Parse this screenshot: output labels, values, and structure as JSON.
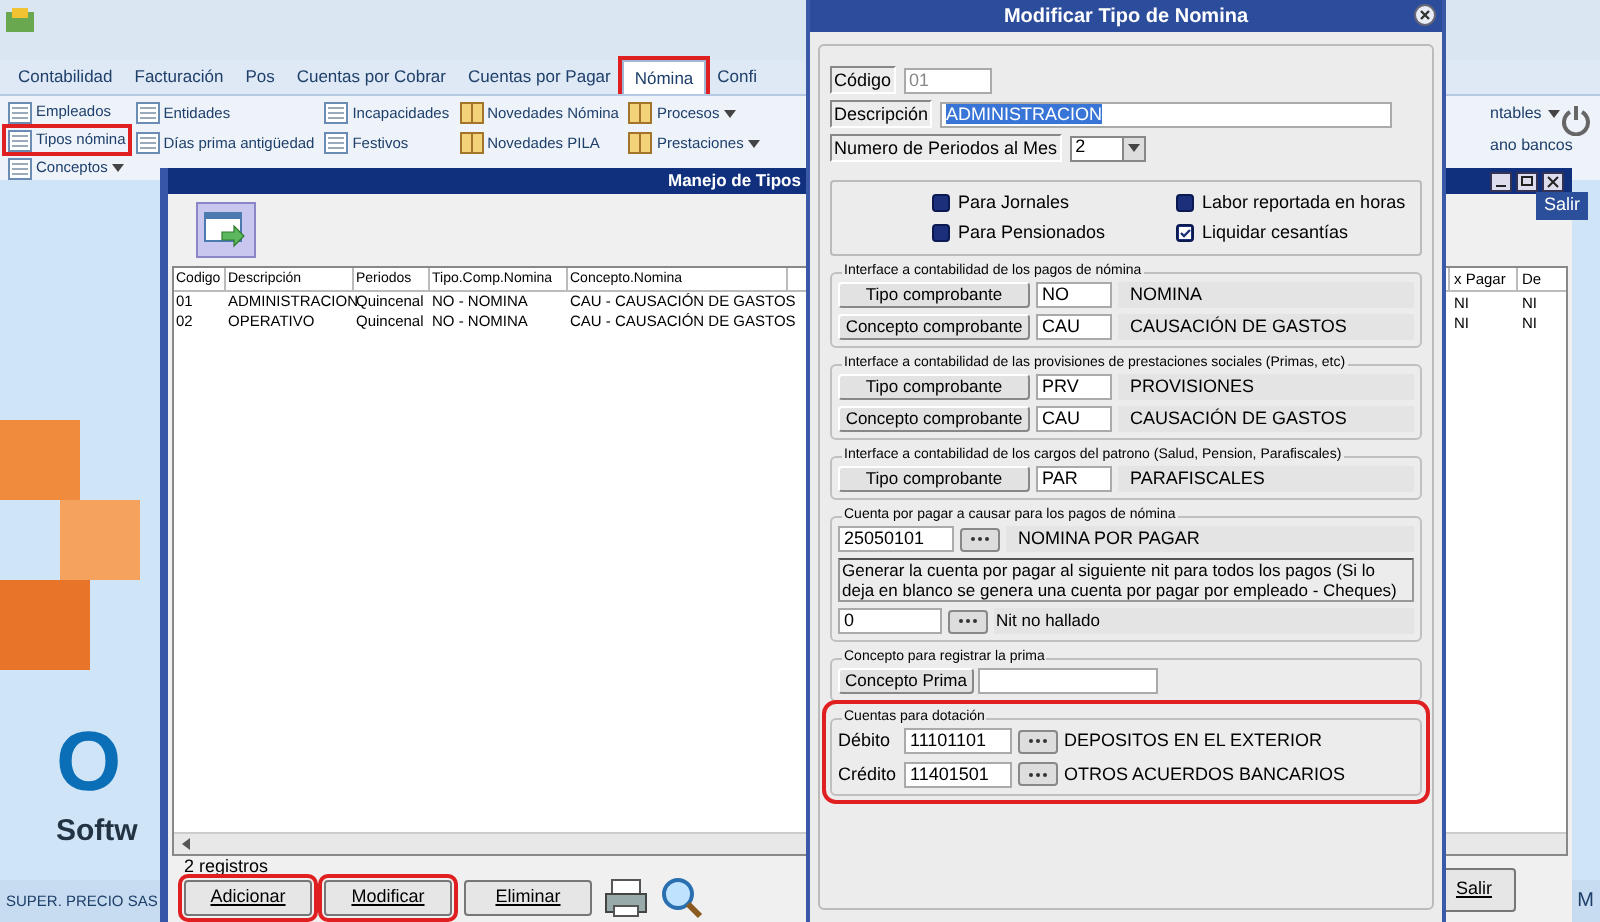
{
  "ribbon": {
    "tabs": [
      {
        "label": "Contabilidad",
        "selected": false,
        "highlighted": false
      },
      {
        "label": "Facturación",
        "selected": false,
        "highlighted": false
      },
      {
        "label": "Pos",
        "selected": false,
        "highlighted": false
      },
      {
        "label": "Cuentas por Cobrar",
        "selected": false,
        "highlighted": false
      },
      {
        "label": "Cuentas por Pagar",
        "selected": false,
        "highlighted": false
      },
      {
        "label": "Nómina",
        "selected": true,
        "highlighted": true
      },
      {
        "label": "Confi",
        "selected": false,
        "highlighted": false
      }
    ],
    "columns": [
      [
        {
          "label": "Empleados",
          "kind": "plain",
          "highlighted": false
        },
        {
          "label": "Tipos nómina",
          "kind": "plain",
          "highlighted": true
        },
        {
          "label": "Conceptos",
          "kind": "menu",
          "highlighted": false
        }
      ],
      [
        {
          "label": "Entidades",
          "kind": "plain",
          "highlighted": false
        },
        {
          "label": "Días prima antigüedad",
          "kind": "plain",
          "highlighted": false
        }
      ],
      [
        {
          "label": "Incapacidades",
          "kind": "plain",
          "highlighted": false
        },
        {
          "label": "Festivos",
          "kind": "plain",
          "highlighted": false
        }
      ],
      [
        {
          "label": "Novedades Nómina",
          "kind": "book",
          "highlighted": false
        },
        {
          "label": "Novedades PILA",
          "kind": "book",
          "highlighted": false
        }
      ],
      [
        {
          "label": "Procesos",
          "kind": "bookmenu",
          "highlighted": false
        },
        {
          "label": "Prestaciones",
          "kind": "bookmenu",
          "highlighted": false
        }
      ]
    ],
    "right_items": [
      {
        "label": "ntables",
        "kind": "menu"
      },
      {
        "label": "ano bancos",
        "kind": "plain"
      }
    ],
    "exit_label": "Salir"
  },
  "background": {
    "logo_big": "O",
    "logo_small": "Softw"
  },
  "list_window": {
    "title": "Manejo de Tipos",
    "columns": [
      "Codigo",
      "Descripción",
      "Periodos",
      "Tipo.Comp.Nomina",
      "Concepto.Nomina"
    ],
    "rows": [
      [
        "01",
        "ADMINISTRACION",
        "Quincenal",
        "NO - NOMINA",
        "CAU - CAUSACIÓN DE GASTOS"
      ],
      [
        "02",
        "OPERATIVO",
        "Quincenal",
        "NO - NOMINA",
        "CAU - CAUSACIÓN DE GASTOS"
      ]
    ],
    "right_columns": [
      "x Pagar",
      "De"
    ],
    "right_rows": [
      [
        "NI",
        "NI"
      ],
      [
        "NI",
        "NI"
      ]
    ],
    "record_count": "2 registros",
    "buttons": [
      {
        "label": "Adicionar",
        "highlighted": true
      },
      {
        "label": "Modificar",
        "highlighted": true
      },
      {
        "label": "Eliminar",
        "highlighted": false
      }
    ],
    "exit_button": "Salir"
  },
  "dialog": {
    "title": "Modificar Tipo de Nomina",
    "code": {
      "label": "Código",
      "value": "01"
    },
    "description": {
      "label": "Descripción",
      "value": "ADMINISTRACION"
    },
    "periods": {
      "label": "Numero de Periodos al Mes",
      "value": "2"
    },
    "checkboxes": [
      {
        "label": "Para Jornales",
        "checked": false
      },
      {
        "label": "Labor reportada en horas",
        "checked": false
      },
      {
        "label": "Para Pensionados",
        "checked": false
      },
      {
        "label": "Liquidar cesantías",
        "checked": true
      }
    ],
    "groups": [
      {
        "kind": "comprobantes",
        "title": "Interface a contabilidad de los pagos de nómina",
        "highlighted": false,
        "rows": [
          {
            "button": "Tipo comprobante",
            "value": "NO",
            "description": "NOMINA"
          },
          {
            "button": "Concepto comprobante",
            "value": "CAU",
            "description": "CAUSACIÓN DE GASTOS"
          }
        ]
      },
      {
        "kind": "comprobantes",
        "title": "Interface a contabilidad de las provisiones de prestaciones sociales (Primas, etc)",
        "highlighted": false,
        "rows": [
          {
            "button": "Tipo comprobante",
            "value": "PRV",
            "description": "PROVISIONES"
          },
          {
            "button": "Concepto comprobante",
            "value": "CAU",
            "description": "CAUSACIÓN DE GASTOS"
          }
        ]
      },
      {
        "kind": "comprobantes",
        "title": "Interface a contabilidad de los cargos del patrono (Salud, Pension, Parafiscales)",
        "highlighted": false,
        "rows": [
          {
            "button": "Tipo comprobante",
            "value": "PAR",
            "description": "PARAFISCALES"
          }
        ]
      },
      {
        "kind": "payable",
        "title": "Cuenta por pagar a causar para los pagos de nómina",
        "highlighted": false,
        "account": "25050101",
        "account_name": "NOMINA POR PAGAR",
        "note": "Generar la cuenta por pagar al siguiente nit para todos los pagos (Si lo deja en blanco se genera una cuenta por pagar por empleado - Cheques)",
        "nit": "0",
        "nit_name": "Nit no hallado"
      },
      {
        "kind": "prima",
        "title": "Concepto para registrar la prima",
        "highlighted": false,
        "button": "Concepto Prima"
      },
      {
        "kind": "accounts",
        "title": "Cuentas para dotación",
        "highlighted": true,
        "rows": [
          {
            "label": "Débito",
            "value": "11101101",
            "description": "DEPOSITOS EN EL EXTERIOR"
          },
          {
            "label": "Crédito",
            "value": "11401501",
            "description": "OTROS ACUERDOS BANCARIOS"
          }
        ]
      }
    ]
  },
  "status_bar": {
    "left": "SUPER. PRECIO SAS",
    "right": "M"
  }
}
